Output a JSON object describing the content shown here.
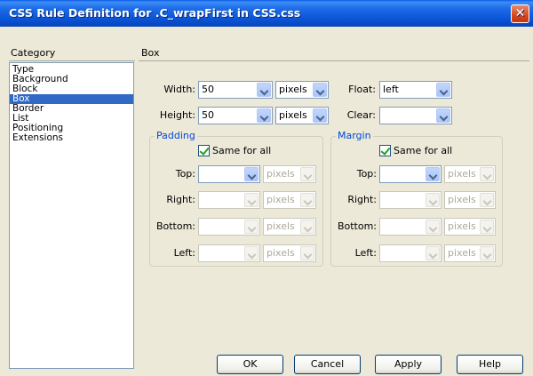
{
  "window": {
    "title": "CSS Rule Definition for .C_wrapFirst in CSS.css",
    "close_glyph": "✕"
  },
  "category": {
    "label": "Category",
    "items": [
      "Type",
      "Background",
      "Block",
      "Box",
      "Border",
      "List",
      "Positioning",
      "Extensions"
    ],
    "selected": "Box"
  },
  "section": {
    "label": "Box"
  },
  "box": {
    "width_label": "Width:",
    "width_value": "50",
    "width_unit": "pixels",
    "height_label": "Height:",
    "height_value": "50",
    "height_unit": "pixels",
    "float_label": "Float:",
    "float_value": "left",
    "clear_label": "Clear:",
    "clear_value": ""
  },
  "padding": {
    "title": "Padding",
    "same_for_all": "Same for all",
    "same_checked": true,
    "top_label": "Top:",
    "right_label": "Right:",
    "bottom_label": "Bottom:",
    "left_label": "Left:",
    "unit": "pixels"
  },
  "margin": {
    "title": "Margin",
    "same_for_all": "Same for all",
    "same_checked": true,
    "top_label": "Top:",
    "right_label": "Right:",
    "bottom_label": "Bottom:",
    "left_label": "Left:",
    "unit": "pixels"
  },
  "buttons": {
    "ok": "OK",
    "cancel": "Cancel",
    "apply": "Apply",
    "help": "Help"
  },
  "colors": {
    "titlebar": "#0a55d9",
    "selection": "#316ac5",
    "group_title": "#0046d5",
    "dialog_bg": "#ece9d8"
  }
}
